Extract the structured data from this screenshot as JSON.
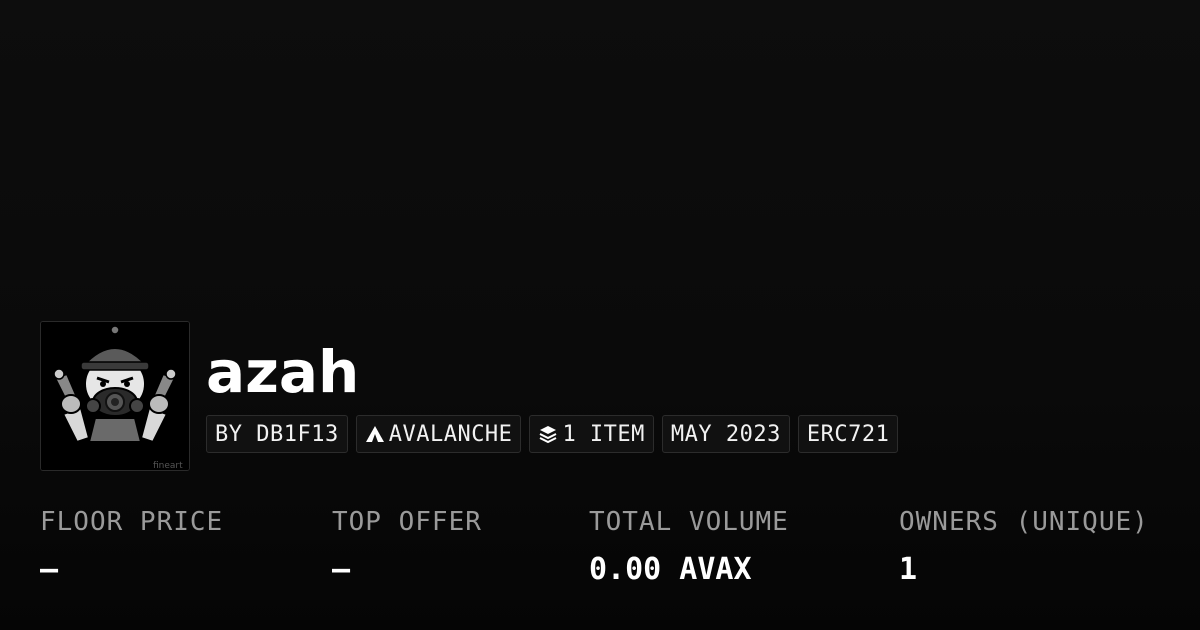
{
  "collection": {
    "name": "azah",
    "avatar_watermark": "fineart"
  },
  "tags": [
    {
      "label": "BY DB1F13",
      "icon": ""
    },
    {
      "label": "AVALANCHE",
      "icon": "avalanche-icon"
    },
    {
      "label": "1 ITEM",
      "icon": "layers-icon"
    },
    {
      "label": "MAY 2023",
      "icon": ""
    },
    {
      "label": "ERC721",
      "icon": ""
    }
  ],
  "stats": [
    {
      "label": "FLOOR PRICE",
      "value": "–"
    },
    {
      "label": "TOP OFFER",
      "value": "–"
    },
    {
      "label": "TOTAL VOLUME",
      "value": "0.00 AVAX"
    },
    {
      "label": "OWNERS (UNIQUE)",
      "value": "1"
    }
  ],
  "colors": {
    "background": "#0b0b0b",
    "text": "#ffffff",
    "label": "#9a9a9a",
    "tag_bg": "#111111",
    "tag_border": "#2c2c2c"
  }
}
